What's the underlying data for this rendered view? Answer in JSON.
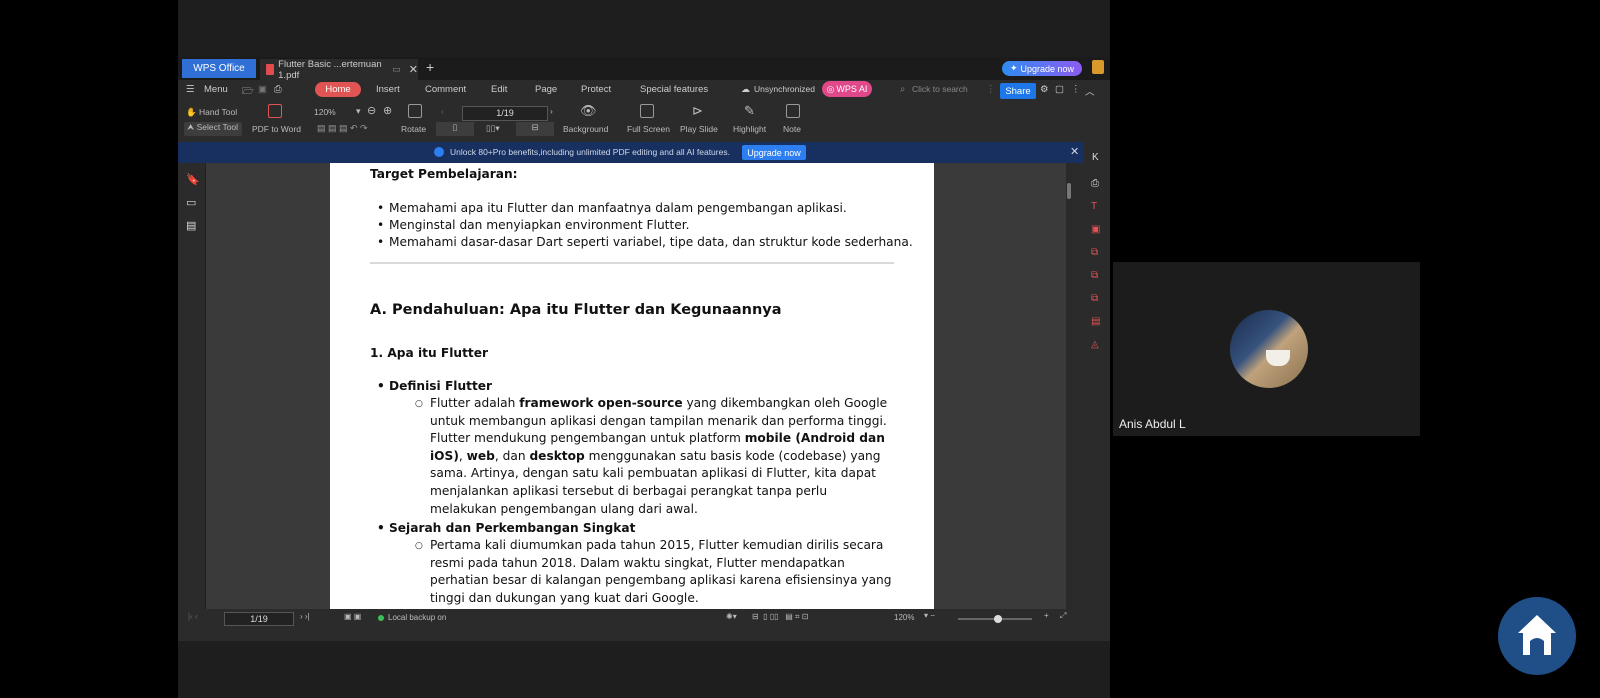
{
  "titlebar": {
    "app_tab": "WPS Office",
    "doc_tab": "Flutter Basic ...ertemuan 1.pdf",
    "upgrade": "Upgrade now"
  },
  "menubar": {
    "menu": "Menu",
    "tabs": [
      "Home",
      "Insert",
      "Comment",
      "Edit",
      "Page",
      "Protect",
      "Special features"
    ],
    "sync": "Unsynchronized",
    "wps_ai": "WPS AI",
    "search_placeholder": "Click to search",
    "share": "Share"
  },
  "toolbar": {
    "hand_tool": "Hand Tool",
    "select_tool": "Select Tool",
    "pdf_to_word": "PDF to Word",
    "zoom": "120%",
    "rotate": "Rotate",
    "page": "1/19",
    "background": "Background",
    "full_screen": "Full Screen",
    "play_slide": "Play Slide",
    "highlight": "Highlight",
    "note": "Note"
  },
  "banner": {
    "text": "Unlock 80+Pro benefits,including unlimited PDF editing and all AI features.",
    "button": "Upgrade now"
  },
  "document": {
    "target_heading": "Target Pembelajaran:",
    "targets": [
      "Memahami apa itu Flutter dan manfaatnya dalam pengembangan aplikasi.",
      "Menginstal dan menyiapkan environment Flutter.",
      "Memahami dasar-dasar Dart seperti variabel, tipe data, dan struktur kode sederhana."
    ],
    "section_a": "A. Pendahuluan: Apa itu Flutter dan Kegunaannya",
    "sub_1": "1. Apa itu Flutter",
    "bullet_def": "Definisi Flutter",
    "def_parts": [
      "Flutter adalah ",
      "framework open-source",
      " yang dikembangkan oleh Google untuk membangun aplikasi dengan tampilan menarik dan performa tinggi. Flutter mendukung pengembangan untuk platform ",
      "mobile (Android dan iOS)",
      ", ",
      "web",
      ", dan ",
      "desktop",
      " menggunakan satu basis kode (codebase) yang sama. Artinya, dengan satu kali pembuatan aplikasi di Flutter, kita dapat menjalankan aplikasi tersebut di berbagai perangkat tanpa perlu melakukan pengembangan ulang dari awal."
    ],
    "bullet_hist": "Sejarah dan Perkembangan Singkat",
    "hist_text": "Pertama kali diumumkan pada tahun 2015, Flutter kemudian dirilis secara resmi pada tahun 2018. Dalam waktu singkat, Flutter mendapatkan perhatian besar di kalangan pengembang aplikasi karena efisiensinya yang tinggi dan dukungan yang kuat dari Google."
  },
  "statusbar": {
    "page": "1/19",
    "backup": "Local backup on",
    "zoom": "120%"
  },
  "meeting": {
    "participant_name": "Anis Abdul L"
  },
  "colors": {
    "accent_red": "#e05454",
    "banner_blue": "#17305f",
    "share_blue": "#1e77e8",
    "wps_ai_pink": "#e0488a"
  }
}
